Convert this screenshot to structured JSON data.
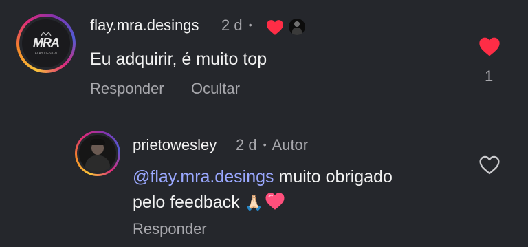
{
  "comment": {
    "username": "flay.mra.desings",
    "time": "2 d",
    "separator": "•",
    "avatar_text": "MRA",
    "avatar_subtext": "FLAY DESIGN",
    "text": "Eu adquirir, é muito top",
    "actions": {
      "reply": "Responder",
      "hide": "Ocultar"
    },
    "likes": "1",
    "colors": {
      "heart": "#fe2d46",
      "meta": "#a8a8ad"
    }
  },
  "reply": {
    "username": "prietowesley",
    "time": "2 d",
    "separator": "•",
    "author_badge": "Autor",
    "mention": "@flay.mra.desings",
    "text_line1": " muito obrigado",
    "text_line2": "pelo feedback ",
    "emoji": "🙏🏻",
    "actions": {
      "reply": "Responder"
    },
    "colors": {
      "mention": "#9aa8ff"
    }
  }
}
